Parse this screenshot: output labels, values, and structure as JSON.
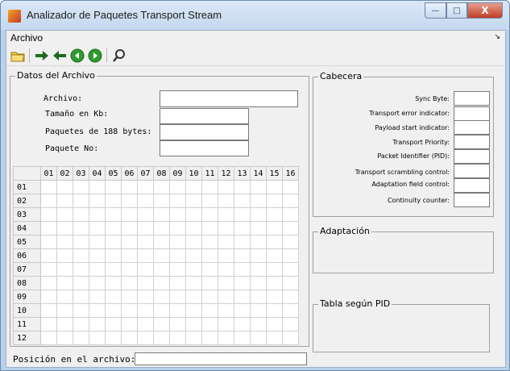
{
  "window": {
    "title": "Analizador de Paquetes Transport Stream",
    "controls": {
      "minimize": "—",
      "maximize": "□",
      "close": "X"
    }
  },
  "menu": {
    "items": [
      "Archivo"
    ],
    "overflow_icon": "chevron-icon"
  },
  "toolbar": {
    "buttons": [
      {
        "name": "open-folder-icon"
      },
      {
        "name": "forward-arrow-icon"
      },
      {
        "name": "back-arrow-icon"
      },
      {
        "name": "previous-round-icon"
      },
      {
        "name": "next-round-icon"
      },
      {
        "name": "search-icon"
      }
    ],
    "colors": {
      "arrows": "#1f6b1f",
      "round_buttons": "#2e9b2e"
    }
  },
  "datos": {
    "title": "Datos del Archivo",
    "fields": [
      {
        "label": "Archivo:",
        "value": ""
      },
      {
        "label": "Tamaño en Kb:",
        "value": ""
      },
      {
        "label": "Paquetes de 188 bytes:",
        "value": ""
      },
      {
        "label": "Paquete No:",
        "value": ""
      }
    ]
  },
  "hex_table": {
    "columns": [
      "01",
      "02",
      "03",
      "04",
      "05",
      "06",
      "07",
      "08",
      "09",
      "10",
      "11",
      "12",
      "13",
      "14",
      "15",
      "16"
    ],
    "rows": [
      "01",
      "02",
      "03",
      "04",
      "05",
      "06",
      "07",
      "08",
      "09",
      "10",
      "11",
      "12"
    ]
  },
  "cabecera": {
    "title": "Cabecera",
    "fields": [
      {
        "label": "Sync Byte:",
        "value": ""
      },
      {
        "label": "Transport error indicator:",
        "value": ""
      },
      {
        "label": "Payload start indicator:",
        "value": ""
      },
      {
        "label": "Transport Priority:",
        "value": ""
      },
      {
        "label": "Packet Identifier (PID):",
        "value": ""
      },
      {
        "label": "Transport scrambling control:",
        "value": ""
      },
      {
        "label": "Adaptation field control:",
        "value": ""
      },
      {
        "label": "Continuity counter:",
        "value": ""
      }
    ]
  },
  "adaptacion": {
    "title": "Adaptación"
  },
  "tabla_pid": {
    "title": "Tabla según PID"
  },
  "posicion": {
    "label": "Posición en el archivo:",
    "value": ""
  }
}
